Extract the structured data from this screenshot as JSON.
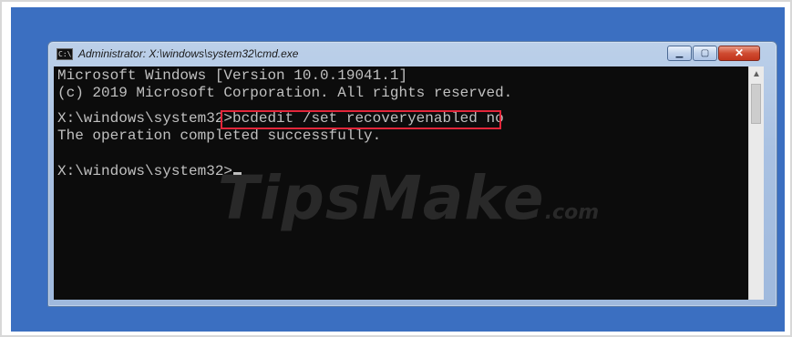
{
  "window": {
    "title": "Administrator: X:\\windows\\system32\\cmd.exe",
    "icon_text": "C:\\",
    "minimize_glyph": "▁",
    "maximize_glyph": "▢",
    "close_glyph": "✕"
  },
  "console": {
    "lines": [
      "Microsoft Windows [Version 10.0.19041.1]",
      "(c) 2019 Microsoft Corporation. All rights reserved.",
      "X:\\windows\\system32>bcdedit /set recoveryenabled no",
      "The operation completed successfully.",
      "X:\\windows\\system32>"
    ],
    "highlighted_command": "bcdedit /set recoveryenabled no"
  },
  "scrollbar": {
    "up_glyph": "▲"
  },
  "watermark": {
    "text": "TipsMake",
    "suffix": ".com"
  },
  "colors": {
    "desktop": "#3b6fc1",
    "console_bg": "#0c0c0c",
    "console_text": "#c0c0c0",
    "highlight_border": "#e2263a"
  }
}
